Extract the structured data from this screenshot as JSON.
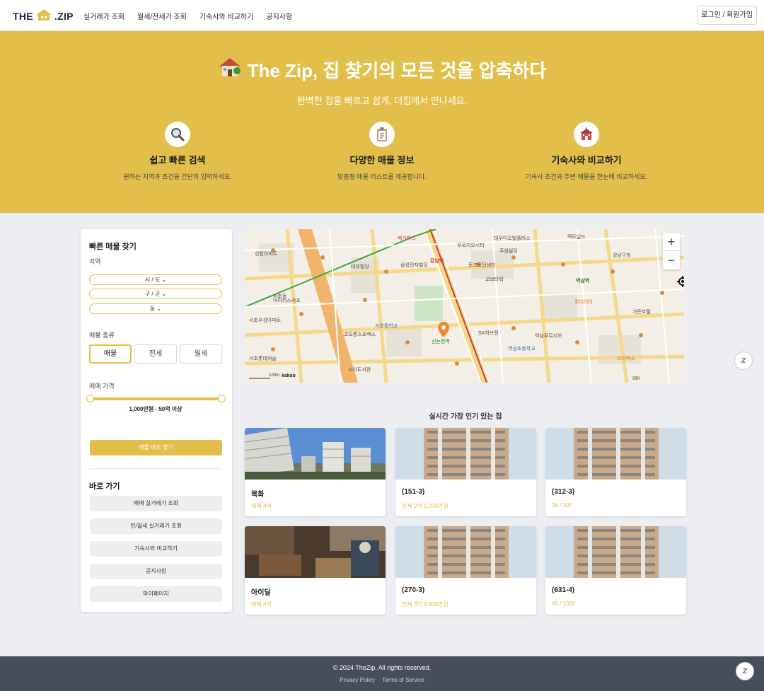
{
  "nav": {
    "logo_left": "THE",
    "logo_right": ".ZIP",
    "links": [
      "실거래가 조회",
      "월세/전세가 조회",
      "기숙사와 비교하기",
      "공지사항"
    ],
    "login": "로그인 / 회원가입"
  },
  "hero": {
    "title": "The Zip, 집 찾기의 모든 것을 압축하다",
    "subtitle": "완벽한 집을 빠르고 쉽게, 더집에서 만나세요.",
    "features": [
      {
        "icon": "magnifier-icon",
        "title": "쉽고 빠른 검색",
        "desc": "원하는 지역과 조건을 간단히 입력하세요."
      },
      {
        "icon": "clipboard-icon",
        "title": "다양한 매물 정보",
        "desc": "맞춤형 매물 리스트를 제공합니다."
      },
      {
        "icon": "school-icon",
        "title": "기숙사와 비교하기",
        "desc": "기숙사 조건과 주변 매물을 한눈에 비교하세요."
      }
    ]
  },
  "sidebar": {
    "title": "빠른 매물 찾기",
    "region_label": "지역",
    "selects": [
      "시 / 도 ⌄",
      "구 / 군 ⌄",
      "동 ⌄"
    ],
    "type_label": "매물 종류",
    "types": [
      "매물",
      "전세",
      "월세"
    ],
    "active_type": "매물",
    "price_label": "매매 가격",
    "price_range": "1,000만원 - 50억 이상",
    "search_button": "매물 바로 찾기",
    "shortcut_title": "바로 가기",
    "shortcuts": [
      "매매 실거래가 조회",
      "전/월세 실거래가 조회",
      "기숙사와 비교하기",
      "공지사항",
      "마이페이지"
    ]
  },
  "map": {
    "zoom_in": "+",
    "zoom_out": "−",
    "scale": "100m",
    "provider": "kakao",
    "labels": [
      "성원아파트",
      "대유빌딩",
      "대우디오빌플러스",
      "삼성전자빌딩",
      "강남역",
      "토즈모던센터",
      "교보타워",
      "역삼역",
      "서초동",
      "서운중학교",
      "코오롱스포렉스",
      "신논현역",
      "서이도서관",
      "역삼초등학교",
      "서초우성아파트",
      "강남구청",
      "SK허브렌",
      "역삼푸르지오",
      "스타벅스",
      "롯데리아",
      "서초롯데캐슬",
      "푸르지오시티",
      "맥도날드",
      "메가박스",
      "주원빌딩",
      "가든호텔",
      "아이리스서초",
      "IBK"
    ]
  },
  "popular": {
    "title": "실시간 가장 인기 있는 집",
    "cards": [
      {
        "name": "목화",
        "price": "매매 4억"
      },
      {
        "name": "(151-3)",
        "price": "전세 2억 5,000만원"
      },
      {
        "name": "(312-3)",
        "price": "36 / 300"
      },
      {
        "name": "아이딜",
        "price": "매매 4억"
      },
      {
        "name": "(270-3)",
        "price": "전세 3억 9,800만원"
      },
      {
        "name": "(631-4)",
        "price": "45 / 1000"
      }
    ]
  },
  "footer": {
    "copyright": "© 2024 TheZip. All rights reserved.",
    "privacy": "Privacy Policy",
    "terms": "Terms of Service"
  },
  "floating_button": "𝑧",
  "colors": {
    "accent": "#e2bf4b",
    "footer_bg": "#474d5a",
    "page_bg": "#eceef1"
  }
}
